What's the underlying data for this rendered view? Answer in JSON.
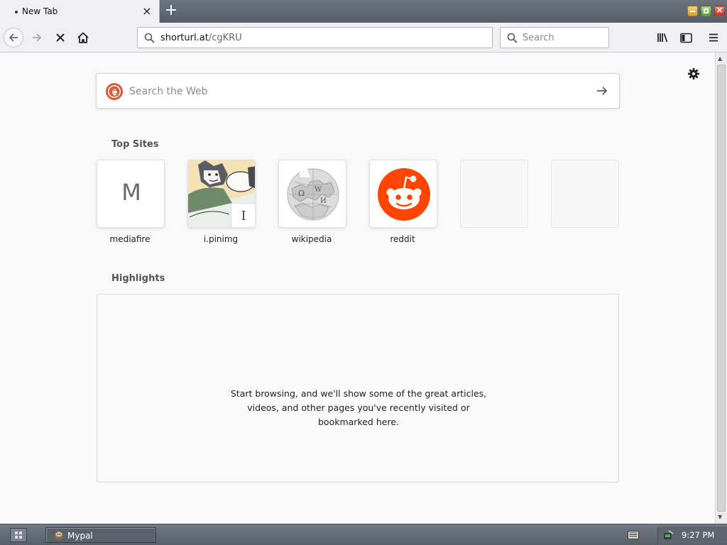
{
  "tab": {
    "title": "New Tab",
    "close": "×"
  },
  "newtab_label": "+",
  "window_controls": {
    "close_glyph": "×"
  },
  "urlbar": {
    "host": "shorturl.at",
    "path": "/cgKRU"
  },
  "searchbar": {
    "placeholder": "Search"
  },
  "websearch": {
    "placeholder": "Search the Web"
  },
  "top_sites": {
    "title": "Top Sites",
    "sites": [
      {
        "label": "mediafire",
        "letter": "M"
      },
      {
        "label": "i.pinimg",
        "badge": "I"
      },
      {
        "label": "wikipedia",
        "wiki_glyphs": [
          "Ω",
          "W",
          "И"
        ]
      },
      {
        "label": "reddit"
      },
      {
        "label": ""
      },
      {
        "label": ""
      }
    ]
  },
  "highlights": {
    "title": "Highlights",
    "empty_lines": [
      "Start browsing, and we'll show some of the great articles,",
      "videos, and other pages you've recently visited or",
      "bookmarked here."
    ]
  },
  "taskbar": {
    "task_label": "Mypal",
    "clock": "9:27 PM"
  },
  "colors": {
    "reddit": "#ff4500",
    "duckduckgo": "#de5833",
    "accent": "#0a84ff"
  },
  "icons": [
    "back-icon",
    "forward-icon",
    "stop-icon",
    "home-icon",
    "search-icon",
    "library-icon",
    "sidebar-icon",
    "menu-icon",
    "gear-icon",
    "arrow-right-icon",
    "keyboard-icon",
    "network-icon"
  ]
}
